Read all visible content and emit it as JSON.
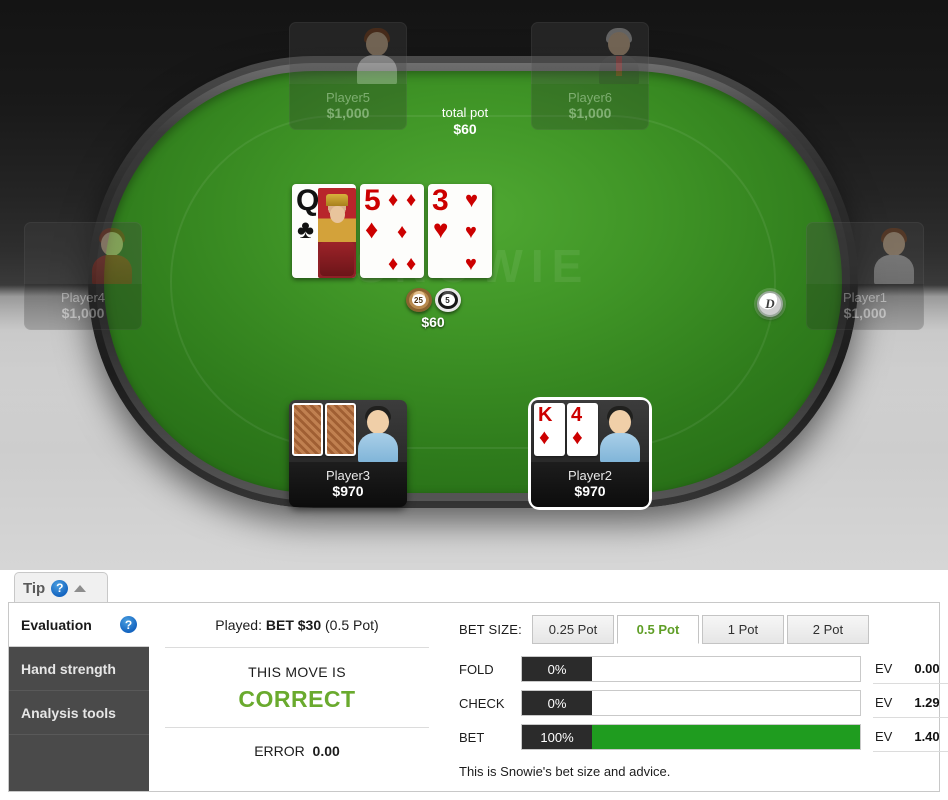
{
  "table": {
    "watermark": "SNOWIE",
    "total_pot_label": "total pot",
    "total_pot_value": "$60",
    "pot_amount": "$60",
    "dealer_button": "D",
    "chips": [
      {
        "denomination": "25",
        "name": "chip-25"
      },
      {
        "denomination": "5",
        "name": "chip-5"
      }
    ],
    "board_cards": [
      {
        "rank": "Q",
        "suit": "♣",
        "color": "black",
        "name": "board-card-queen-clubs"
      },
      {
        "rank": "5",
        "suit": "♦",
        "color": "red",
        "name": "board-card-five-diamonds"
      },
      {
        "rank": "3",
        "suit": "♥",
        "color": "red",
        "name": "board-card-three-hearts"
      }
    ],
    "seats": [
      {
        "name": "Player5",
        "stack": "$1,000",
        "state": "inactive",
        "avatar": "p-f1"
      },
      {
        "name": "Player6",
        "stack": "$1,000",
        "state": "inactive",
        "avatar": "p-suit"
      },
      {
        "name": "Player4",
        "stack": "$1,000",
        "state": "inactive",
        "avatar": "p-red"
      },
      {
        "name": "Player1",
        "stack": "$1,000",
        "state": "inactive",
        "avatar": "p-f1"
      },
      {
        "name": "Player3",
        "stack": "$970",
        "state": "active",
        "avatar": "p-blue",
        "cards": "hidden"
      },
      {
        "name": "Player2",
        "stack": "$970",
        "state": "hero",
        "avatar": "p-blue",
        "cards": [
          {
            "rank": "K",
            "suit": "♦",
            "color": "red"
          },
          {
            "rank": "4",
            "suit": "♦",
            "color": "red"
          }
        ]
      }
    ]
  },
  "tip_tab": {
    "label": "Tip",
    "help_icon": "?",
    "collapse_icon": "caret-up"
  },
  "panel": {
    "side_tabs": [
      {
        "label": "Evaluation",
        "active": true,
        "help": "?"
      },
      {
        "label": "Hand strength",
        "active": false
      },
      {
        "label": "Analysis tools",
        "active": false
      }
    ],
    "evaluation": {
      "played_prefix": "Played:",
      "played_action": "BET $30",
      "played_suffix": "(0.5 Pot)",
      "move_is": "THIS MOVE IS",
      "verdict": "CORRECT",
      "verdict_color": "#6aaa2e",
      "error_label": "ERROR",
      "error_value": "0.00"
    },
    "advice": {
      "bet_size_label": "BET SIZE:",
      "bet_size_tabs": [
        {
          "label": "0.25 Pot",
          "active": false
        },
        {
          "label": "0.5 Pot",
          "active": true
        },
        {
          "label": "1 Pot",
          "active": false
        },
        {
          "label": "2 Pot",
          "active": false
        }
      ],
      "actions": [
        {
          "name": "FOLD",
          "percent": "0%",
          "fill": 0,
          "ev_label": "EV",
          "ev_value": "0.00"
        },
        {
          "name": "CHECK",
          "percent": "0%",
          "fill": 0,
          "ev_label": "EV",
          "ev_value": "1.29"
        },
        {
          "name": "BET",
          "percent": "100%",
          "fill": 100,
          "ev_label": "EV",
          "ev_value": "1.40"
        }
      ],
      "note": "This is Snowie's bet size and advice."
    }
  }
}
